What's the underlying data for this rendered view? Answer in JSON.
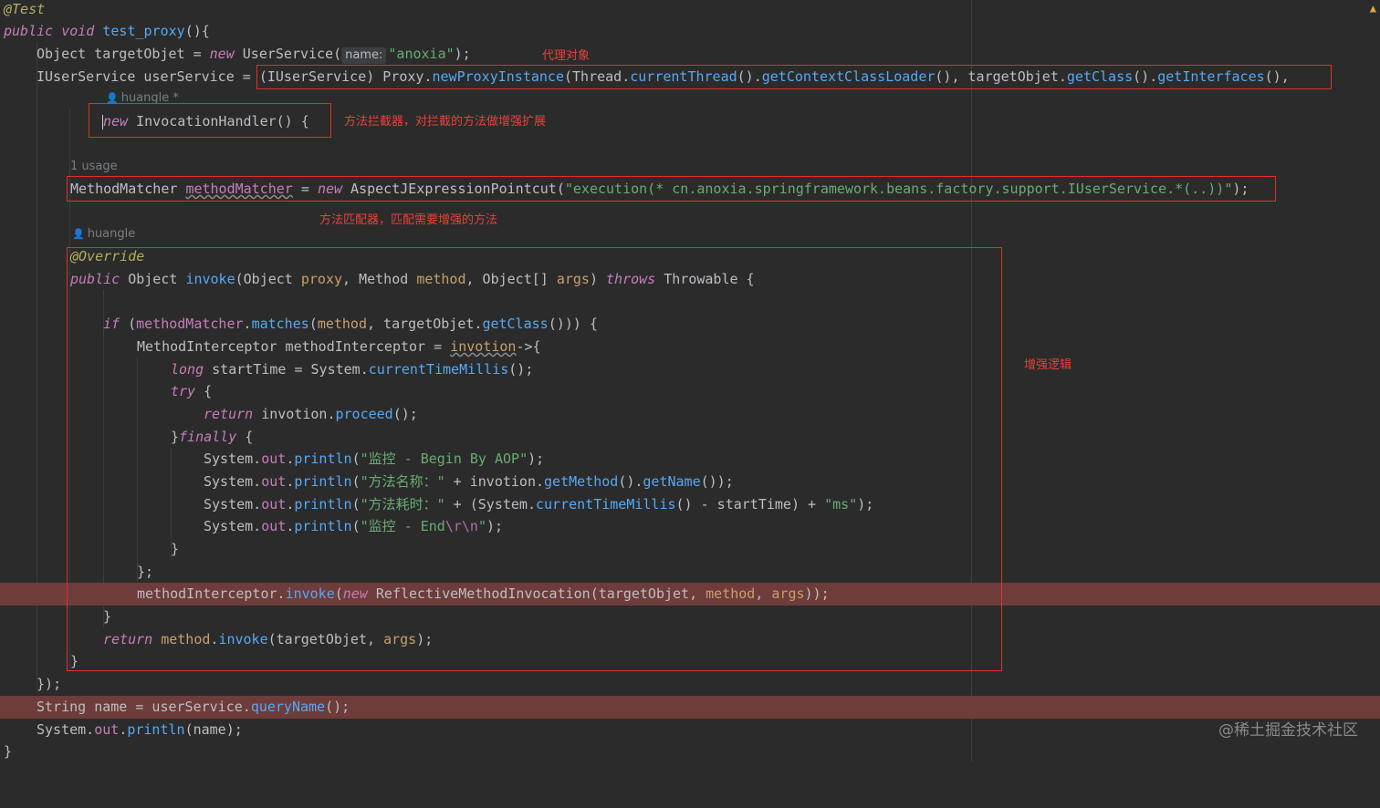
{
  "lines": {
    "l1": "@Test",
    "l2_kw": "public void ",
    "l2_fn": "test_proxy",
    "l2_rest": "(){",
    "l3_a": "Object targetObjet = ",
    "l3_new": "new",
    "l3_b": " UserService(",
    "l3_hint": "name:",
    "l3_str": "\"anoxia\"",
    "l3_c": ");",
    "l4_a": "IUserService userService = ",
    "l4_b": "(IUserService) Proxy.",
    "l4_fn1": "newProxyInstance",
    "l4_c": "(Thread.",
    "l4_fn2": "currentThread",
    "l4_d": "().",
    "l4_fn3": "getContextClassLoader",
    "l4_e": "(), targetObjet.",
    "l4_fn4": "getClass",
    "l4_f": "().",
    "l4_fn5": "getInterfaces",
    "l4_g": "(),",
    "l5_new": "new",
    "l5_rest": " InvocationHandler() {",
    "l7_a": "MethodMatcher ",
    "l7_var": "methodMatcher",
    "l7_b": " = ",
    "l7_new": "new",
    "l7_c": " AspectJExpressionPointcut(",
    "l7_str": "\"execution(* cn.anoxia.springframework.beans.factory.support.IUserService.*(..))\"",
    "l7_d": ");",
    "l8": "@Override",
    "l9_kw": "public",
    "l9_a": " Object ",
    "l9_fn": "invoke",
    "l9_b": "(Object ",
    "l9_p1": "proxy",
    "l9_c": ", Method ",
    "l9_p2": "method",
    "l9_d": ", Object[] ",
    "l9_p3": "args",
    "l9_e": ") ",
    "l9_throws": "throws",
    "l9_f": " Throwable {",
    "l11_if": "if",
    "l11_a": " (",
    "l11_var": "methodMatcher",
    "l11_b": ".",
    "l11_fn": "matches",
    "l11_c": "(",
    "l11_p": "method",
    "l11_d": ", targetObjet.",
    "l11_fn2": "getClass",
    "l11_e": "())) {",
    "l12_a": "MethodInterceptor methodInterceptor = ",
    "l12_p": "invotion",
    "l12_b": "->{",
    "l13_kw": "long",
    "l13_a": " startTime = System.",
    "l13_fn": "currentTimeMillis",
    "l13_b": "();",
    "l14_kw": "try",
    "l14_a": " {",
    "l15_kw": "return",
    "l15_a": " invotion.",
    "l15_fn": "proceed",
    "l15_b": "();",
    "l16_a": "}",
    "l16_kw": "finally",
    "l16_b": " {",
    "l17_a": "System.",
    "l17_f": "out",
    "l17_b": ".",
    "l17_fn": "println",
    "l17_c": "(",
    "l17_str": "\"监控 - Begin By AOP\"",
    "l17_d": ");",
    "l18_str": "\"方法名称：\"",
    "l18_a": " + invotion.",
    "l18_fn": "getMethod",
    "l18_b": "().",
    "l18_fn2": "getName",
    "l18_c": "());",
    "l19_str": "\"方法耗时：\"",
    "l19_a": " + (System.",
    "l19_fn": "currentTimeMillis",
    "l19_b": "() - startTime) + ",
    "l19_str2": "\"ms\"",
    "l19_c": ");",
    "l20_str": "\"监控 - End",
    "l20_esc": "\\r\\n",
    "l20_str2": "\"",
    "l20_c": ");",
    "l21": "}",
    "l22": "};",
    "l23_a": "methodInterceptor.",
    "l23_fn": "invoke",
    "l23_b": "(",
    "l23_new": "new",
    "l23_c": " ReflectiveMethodInvocation(targetObjet, ",
    "l23_p1": "method",
    "l23_d": ", ",
    "l23_p2": "args",
    "l23_e": "));",
    "l24": "}",
    "l25_kw": "return",
    "l25_a": " ",
    "l25_p": "method",
    "l25_b": ".",
    "l25_fn": "invoke",
    "l25_c": "(targetObjet, ",
    "l25_p2": "args",
    "l25_d": ");",
    "l26": "}",
    "l27": "});",
    "l28_a": "String name = userService.",
    "l28_fn": "queryName",
    "l28_b": "();",
    "l29_a": "System.",
    "l29_f": "out",
    "l29_b": ".",
    "l29_fn": "println",
    "l29_c": "(name);",
    "l30": "}"
  },
  "hints": {
    "author1": "huangle *",
    "usage": "1 usage",
    "author2": "huangle"
  },
  "notes": {
    "proxy_object": "代理对象",
    "interceptor": "方法拦截器，对拦截的方法做增强扩展",
    "matcher": "方法匹配器，匹配需要增强的方法",
    "enhance": "增强逻辑"
  },
  "watermark": "@稀土掘金技术社区",
  "colors": {
    "background": "#2b2b2b",
    "keyword": "#c77dbb",
    "function": "#56a8f5",
    "string": "#6aab73",
    "annotation_box": "#e0302b",
    "highlight_line": "#6e3c3a"
  }
}
